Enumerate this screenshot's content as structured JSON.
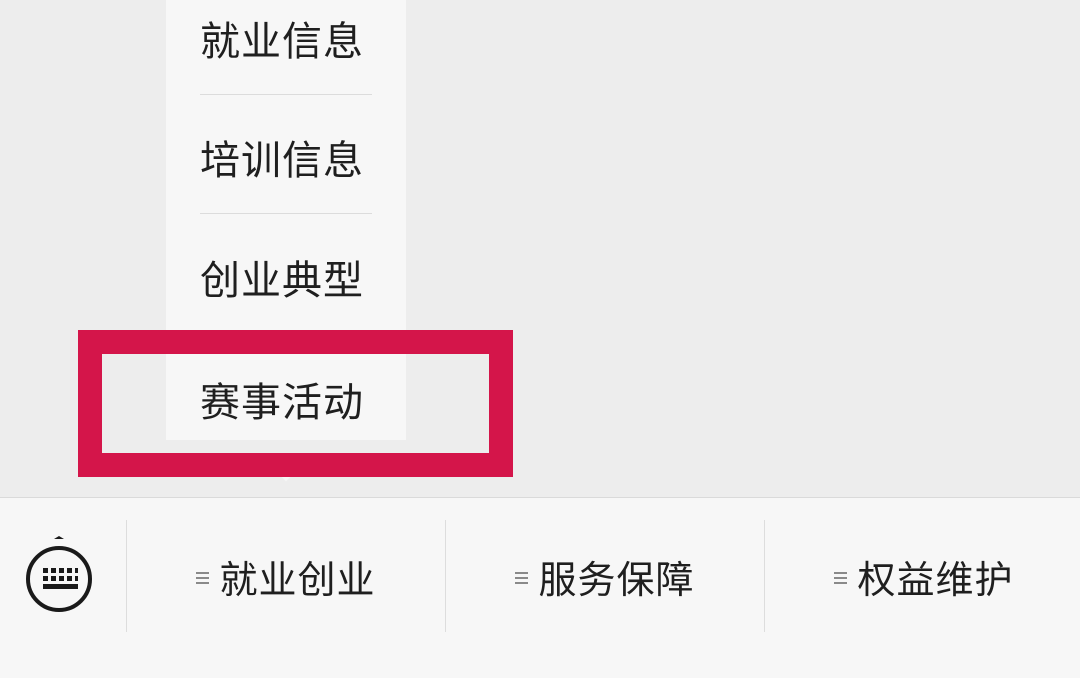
{
  "submenu": {
    "items": [
      {
        "label": "就业信息"
      },
      {
        "label": "培训信息"
      },
      {
        "label": "创业典型"
      },
      {
        "label": "赛事活动"
      }
    ]
  },
  "highlight": {
    "color": "#d4154a"
  },
  "bottom_menu": {
    "keyboard_icon": "keyboard-icon",
    "buttons": [
      {
        "label": "就业创业",
        "icon": "menu-lines-icon"
      },
      {
        "label": "服务保障",
        "icon": "menu-lines-icon"
      },
      {
        "label": "权益维护",
        "icon": "menu-lines-icon"
      }
    ]
  }
}
